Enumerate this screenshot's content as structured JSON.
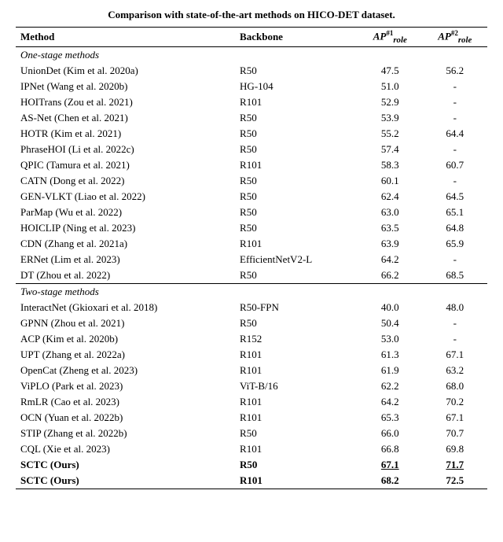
{
  "title": "Comparison with state-of-the-art methods on HICO-DET dataset.",
  "columns": [
    {
      "label": "Method",
      "key": "method"
    },
    {
      "label": "Backbone",
      "key": "backbone"
    },
    {
      "label": "AP",
      "sup": "#1",
      "sub": "role",
      "key": "ap1"
    },
    {
      "label": "AP",
      "sup": "#2",
      "sub": "role",
      "key": "ap2"
    }
  ],
  "sections": [
    {
      "label": "One-stage methods",
      "rows": [
        {
          "method": "UnionDet (Kim et al. 2020a)",
          "backbone": "R50",
          "ap1": "47.5",
          "ap2": "56.2",
          "bold": false
        },
        {
          "method": "IPNet (Wang et al. 2020b)",
          "backbone": "HG-104",
          "ap1": "51.0",
          "ap2": "-",
          "bold": false
        },
        {
          "method": "HOITrans (Zou et al. 2021)",
          "backbone": "R101",
          "ap1": "52.9",
          "ap2": "-",
          "bold": false
        },
        {
          "method": "AS-Net (Chen et al. 2021)",
          "backbone": "R50",
          "ap1": "53.9",
          "ap2": "-",
          "bold": false
        },
        {
          "method": "HOTR (Kim et al. 2021)",
          "backbone": "R50",
          "ap1": "55.2",
          "ap2": "64.4",
          "bold": false
        },
        {
          "method": "PhraseHOI (Li et al. 2022c)",
          "backbone": "R50",
          "ap1": "57.4",
          "ap2": "-",
          "bold": false
        },
        {
          "method": "QPIC (Tamura et al. 2021)",
          "backbone": "R101",
          "ap1": "58.3",
          "ap2": "60.7",
          "bold": false
        },
        {
          "method": "CATN (Dong et al. 2022)",
          "backbone": "R50",
          "ap1": "60.1",
          "ap2": "-",
          "bold": false
        },
        {
          "method": "GEN-VLKT (Liao et al. 2022)",
          "backbone": "R50",
          "ap1": "62.4",
          "ap2": "64.5",
          "bold": false
        },
        {
          "method": "ParMap (Wu et al. 2022)",
          "backbone": "R50",
          "ap1": "63.0",
          "ap2": "65.1",
          "bold": false
        },
        {
          "method": "HOICLIP (Ning et al. 2023)",
          "backbone": "R50",
          "ap1": "63.5",
          "ap2": "64.8",
          "bold": false
        },
        {
          "method": "CDN (Zhang et al. 2021a)",
          "backbone": "R101",
          "ap1": "63.9",
          "ap2": "65.9",
          "bold": false
        },
        {
          "method": "ERNet (Lim et al. 2023)",
          "backbone": "EfficientNetV2-L",
          "ap1": "64.2",
          "ap2": "-",
          "bold": false
        },
        {
          "method": "DT (Zhou et al. 2022)",
          "backbone": "R50",
          "ap1": "66.2",
          "ap2": "68.5",
          "bold": false
        }
      ]
    },
    {
      "label": "Two-stage methods",
      "rows": [
        {
          "method": "InteractNet (Gkioxari et al. 2018)",
          "backbone": "R50-FPN",
          "ap1": "40.0",
          "ap2": "48.0",
          "bold": false
        },
        {
          "method": "GPNN (Zhou et al. 2021)",
          "backbone": "R50",
          "ap1": "50.4",
          "ap2": "-",
          "bold": false
        },
        {
          "method": "ACP (Kim et al. 2020b)",
          "backbone": "R152",
          "ap1": "53.0",
          "ap2": "-",
          "bold": false
        },
        {
          "method": "UPT (Zhang et al. 2022a)",
          "backbone": "R101",
          "ap1": "61.3",
          "ap2": "67.1",
          "bold": false
        },
        {
          "method": "OpenCat (Zheng et al. 2023)",
          "backbone": "R101",
          "ap1": "61.9",
          "ap2": "63.2",
          "bold": false
        },
        {
          "method": "ViPLO (Park et al. 2023)",
          "backbone": "ViT-B/16",
          "ap1": "62.2",
          "ap2": "68.0",
          "bold": false
        },
        {
          "method": "RmLR (Cao et al. 2023)",
          "backbone": "R101",
          "ap1": "64.2",
          "ap2": "70.2",
          "bold": false
        },
        {
          "method": "OCN (Yuan et al. 2022b)",
          "backbone": "R101",
          "ap1": "65.3",
          "ap2": "67.1",
          "bold": false
        },
        {
          "method": "STIP (Zhang et al. 2022b)",
          "backbone": "R50",
          "ap1": "66.0",
          "ap2": "70.7",
          "bold": false
        },
        {
          "method": "CQL (Xie et al. 2023)",
          "backbone": "R101",
          "ap1": "66.8",
          "ap2": "69.8",
          "bold": false
        },
        {
          "method": "SCTC (Ours)",
          "backbone": "R50",
          "ap1": "67.1",
          "ap2": "71.7",
          "bold": false,
          "highlight": true,
          "underline": true
        },
        {
          "method": "SCTC (Ours)",
          "backbone": "R101",
          "ap1": "68.2",
          "ap2": "72.5",
          "bold": true,
          "highlight": true,
          "last": true
        }
      ]
    }
  ]
}
